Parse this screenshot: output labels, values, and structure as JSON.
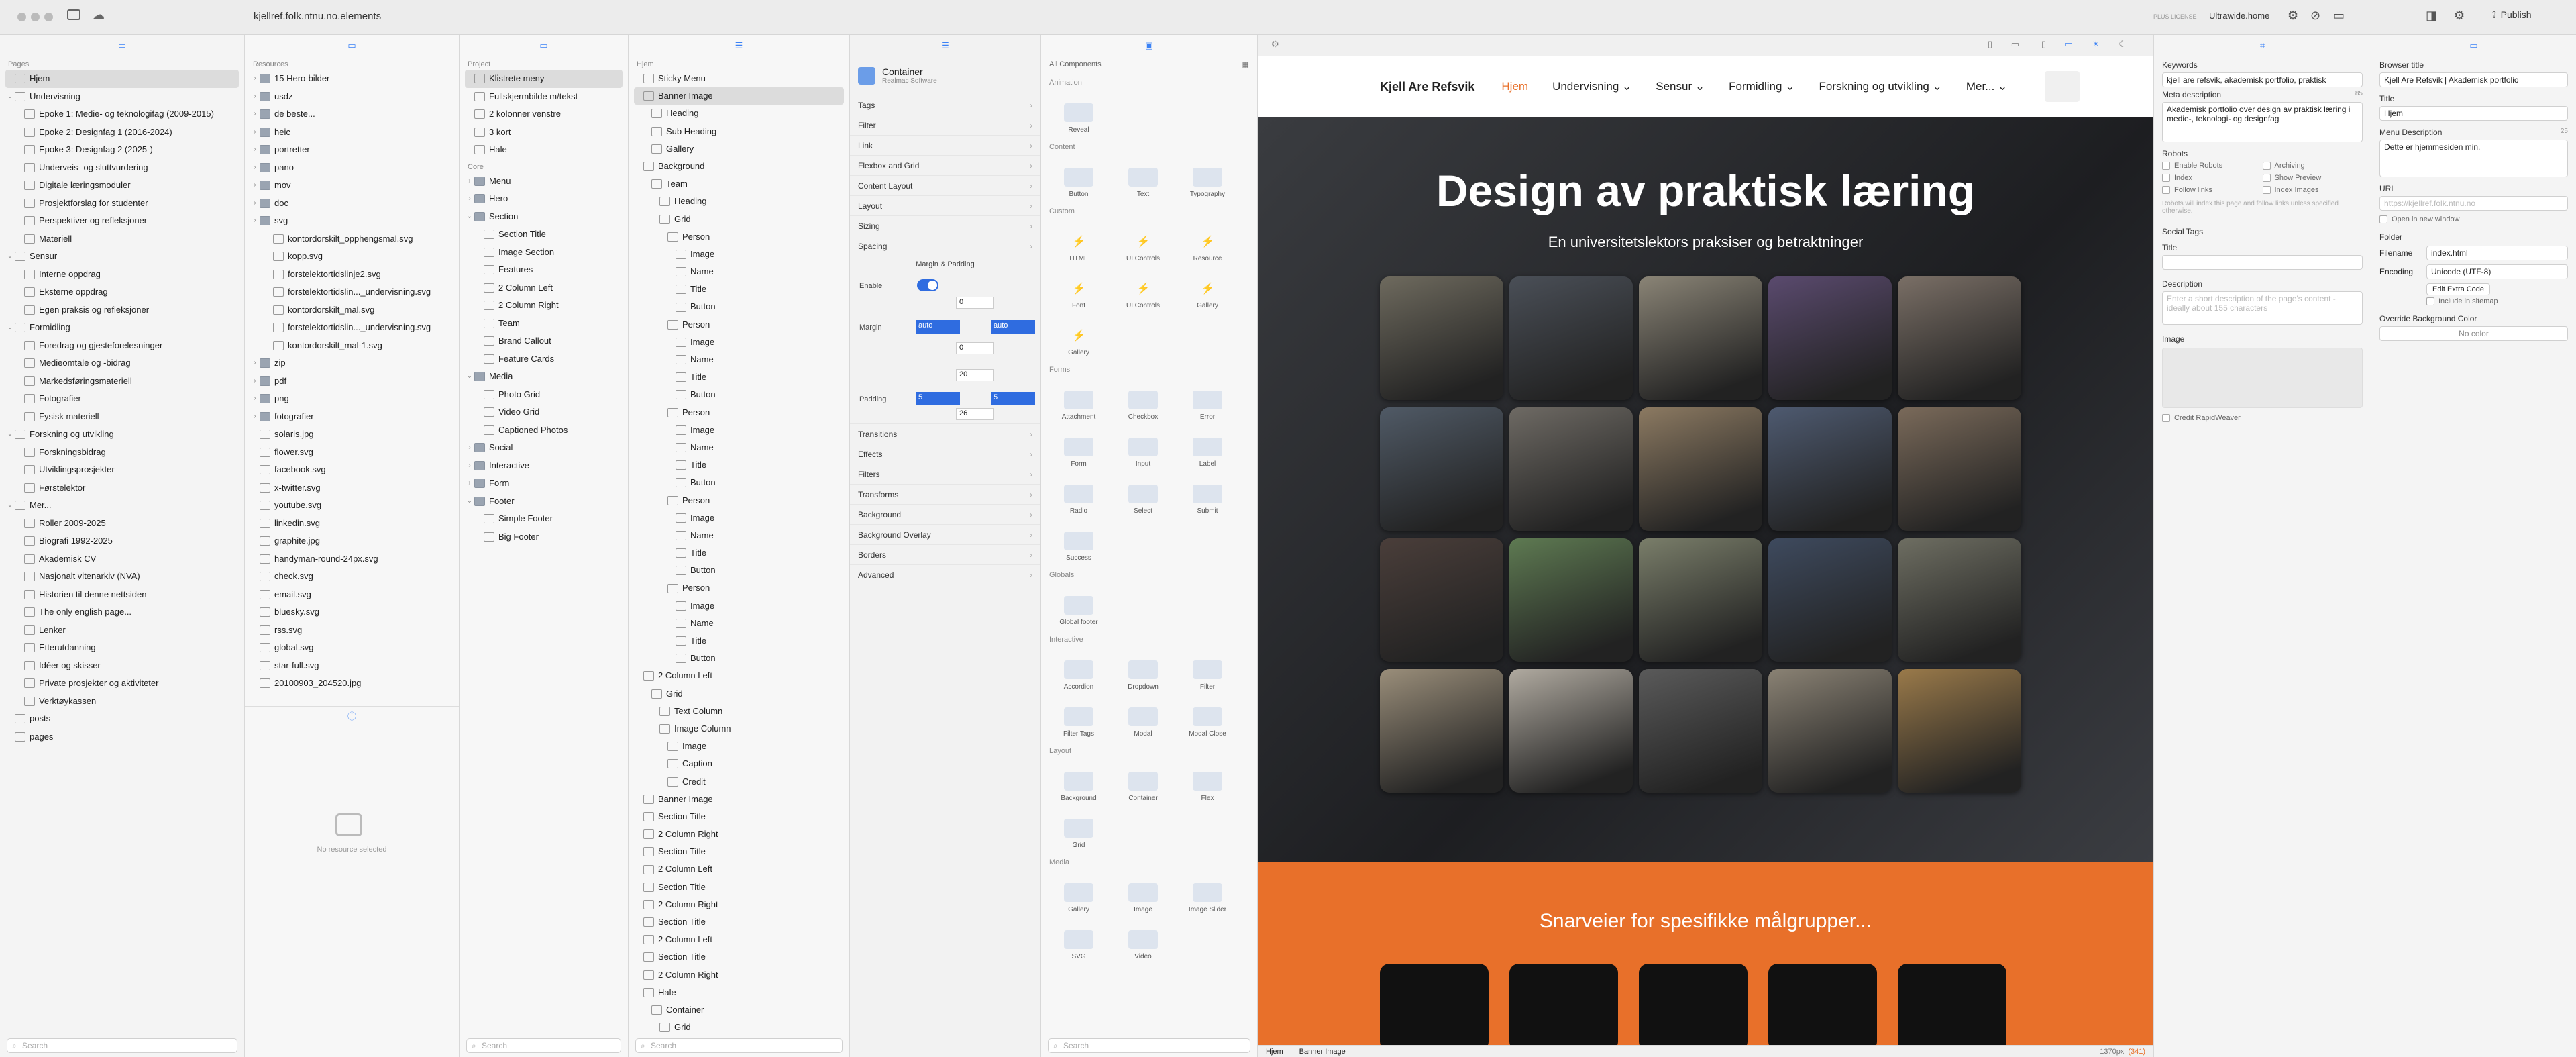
{
  "titlebar": {
    "site_url": "kjellref.folk.ntnu.no.elements",
    "license": "PLUS LICENSE",
    "account": "Ultrawide.home",
    "publish_label": "Publish"
  },
  "pages": {
    "header": "Pages",
    "items": [
      {
        "label": "Hjem",
        "level": 0,
        "selected": true
      },
      {
        "label": "Undervisning",
        "level": 0,
        "open": true
      },
      {
        "label": "Epoke 1: Medie- og teknologifag (2009-2015)",
        "level": 1
      },
      {
        "label": "Epoke 2: Designfag 1 (2016-2024)",
        "level": 1
      },
      {
        "label": "Epoke 3: Designfag 2 (2025-)",
        "level": 1
      },
      {
        "label": "Underveis- og sluttvurdering",
        "level": 1
      },
      {
        "label": "Digitale læringsmoduler",
        "level": 1
      },
      {
        "label": "Prosjektforslag for studenter",
        "level": 1
      },
      {
        "label": "Perspektiver og refleksjoner",
        "level": 1
      },
      {
        "label": "Materiell",
        "level": 1
      },
      {
        "label": "Sensur",
        "level": 0,
        "open": true
      },
      {
        "label": "Interne oppdrag",
        "level": 1
      },
      {
        "label": "Eksterne oppdrag",
        "level": 1
      },
      {
        "label": "Egen praksis og refleksjoner",
        "level": 1
      },
      {
        "label": "Formidling",
        "level": 0,
        "open": true
      },
      {
        "label": "Foredrag og gjesteforelesninger",
        "level": 1
      },
      {
        "label": "Medieomtale og -bidrag",
        "level": 1
      },
      {
        "label": "Markedsføringsmateriell",
        "level": 1
      },
      {
        "label": "Fotografier",
        "level": 1
      },
      {
        "label": "Fysisk materiell",
        "level": 1
      },
      {
        "label": "Forskning og utvikling",
        "level": 0,
        "open": true
      },
      {
        "label": "Forskningsbidrag",
        "level": 1
      },
      {
        "label": "Utviklingsprosjekter",
        "level": 1
      },
      {
        "label": "Førstelektor",
        "level": 1
      },
      {
        "label": "Mer...",
        "level": 0,
        "open": true
      },
      {
        "label": "Roller 2009-2025",
        "level": 1
      },
      {
        "label": "Biografi 1992-2025",
        "level": 1
      },
      {
        "label": "Akademisk CV",
        "level": 1
      },
      {
        "label": "Nasjonalt vitenarkiv (NVA)",
        "level": 1
      },
      {
        "label": "Historien til denne nettsiden",
        "level": 1
      },
      {
        "label": "The only english page...",
        "level": 1
      },
      {
        "label": "Lenker",
        "level": 1
      },
      {
        "label": "Etterutdanning",
        "level": 1
      },
      {
        "label": "Idéer og skisser",
        "level": 1
      },
      {
        "label": "Private prosjekter og aktiviteter",
        "level": 1
      },
      {
        "label": "Verktøykassen",
        "level": 1
      },
      {
        "label": "posts",
        "level": 0
      },
      {
        "label": "pages",
        "level": 0
      }
    ],
    "search_placeholder": "Search"
  },
  "resources": {
    "header": "Resources",
    "items": [
      {
        "label": "15 Hero-bilder",
        "kind": "folder",
        "level": 0
      },
      {
        "label": "usdz",
        "kind": "folder",
        "level": 0
      },
      {
        "label": "de beste...",
        "kind": "folder",
        "level": 0
      },
      {
        "label": "heic",
        "kind": "folder",
        "level": 0
      },
      {
        "label": "portretter",
        "kind": "folder",
        "level": 0
      },
      {
        "label": "pano",
        "kind": "folder",
        "level": 0
      },
      {
        "label": "mov",
        "kind": "folder",
        "level": 0
      },
      {
        "label": "doc",
        "kind": "folder",
        "level": 0
      },
      {
        "label": "svg",
        "kind": "folder",
        "level": 0
      },
      {
        "label": "kontordorskilt_opphengsmal.svg",
        "kind": "file",
        "level": 1
      },
      {
        "label": "kopp.svg",
        "kind": "file",
        "level": 1
      },
      {
        "label": "forstelektortidslinje2.svg",
        "kind": "file",
        "level": 1
      },
      {
        "label": "forstelektortidslin..._undervisning.svg",
        "kind": "file",
        "level": 1
      },
      {
        "label": "kontordorskilt_mal.svg",
        "kind": "file",
        "level": 1
      },
      {
        "label": "forstelektortidslin..._undervisning.svg",
        "kind": "file",
        "level": 1
      },
      {
        "label": "kontordorskilt_mal-1.svg",
        "kind": "file",
        "level": 1
      },
      {
        "label": "zip",
        "kind": "folder",
        "level": 0
      },
      {
        "label": "pdf",
        "kind": "folder",
        "level": 0
      },
      {
        "label": "png",
        "kind": "folder",
        "level": 0
      },
      {
        "label": "fotografier",
        "kind": "folder",
        "level": 0
      },
      {
        "label": "solaris.jpg",
        "kind": "file",
        "level": 0
      },
      {
        "label": "flower.svg",
        "kind": "file",
        "level": 0
      },
      {
        "label": "facebook.svg",
        "kind": "file",
        "level": 0
      },
      {
        "label": "x-twitter.svg",
        "kind": "file",
        "level": 0
      },
      {
        "label": "youtube.svg",
        "kind": "file",
        "level": 0
      },
      {
        "label": "linkedin.svg",
        "kind": "file",
        "level": 0
      },
      {
        "label": "graphite.jpg",
        "kind": "file",
        "level": 0
      },
      {
        "label": "handyman-round-24px.svg",
        "kind": "file",
        "level": 0
      },
      {
        "label": "check.svg",
        "kind": "file",
        "level": 0
      },
      {
        "label": "email.svg",
        "kind": "file",
        "level": 0
      },
      {
        "label": "bluesky.svg",
        "kind": "file",
        "level": 0
      },
      {
        "label": "rss.svg",
        "kind": "file",
        "level": 0
      },
      {
        "label": "global.svg",
        "kind": "file",
        "level": 0
      },
      {
        "label": "star-full.svg",
        "kind": "file",
        "level": 0
      },
      {
        "label": "20100903_204520.jpg",
        "kind": "file",
        "level": 0
      }
    ],
    "search_placeholder": "Search",
    "empty_label": "No resource selected"
  },
  "project": {
    "header": "Project",
    "items": [
      {
        "label": "Klistrete meny",
        "level": 0,
        "selected": true
      },
      {
        "label": "Fullskjermbilde m/tekst",
        "level": 0
      },
      {
        "label": "2 kolonner venstre",
        "level": 0
      },
      {
        "label": "3 kort",
        "level": 0
      },
      {
        "label": "Hale",
        "level": 0
      }
    ],
    "core_header": "Core",
    "core_items": [
      {
        "label": "Menu",
        "level": 0,
        "kind": "folder"
      },
      {
        "label": "Hero",
        "level": 0,
        "kind": "folder"
      },
      {
        "label": "Section",
        "level": 0,
        "kind": "folder",
        "open": true
      },
      {
        "label": "Section Title",
        "level": 1
      },
      {
        "label": "Image Section",
        "level": 1
      },
      {
        "label": "Features",
        "level": 1
      },
      {
        "label": "2 Column Left",
        "level": 1
      },
      {
        "label": "2 Column Right",
        "level": 1
      },
      {
        "label": "Team",
        "level": 1
      },
      {
        "label": "Brand Callout",
        "level": 1
      },
      {
        "label": "Feature Cards",
        "level": 1
      },
      {
        "label": "Media",
        "level": 0,
        "kind": "folder",
        "open": true
      },
      {
        "label": "Photo Grid",
        "level": 1
      },
      {
        "label": "Video Grid",
        "level": 1
      },
      {
        "label": "Captioned Photos",
        "level": 1
      },
      {
        "label": "Social",
        "level": 0,
        "kind": "folder"
      },
      {
        "label": "Interactive",
        "level": 0,
        "kind": "folder"
      },
      {
        "label": "Form",
        "level": 0,
        "kind": "folder"
      },
      {
        "label": "Footer",
        "level": 0,
        "kind": "folder",
        "open": true
      },
      {
        "label": "Simple Footer",
        "level": 1
      },
      {
        "label": "Big Footer",
        "level": 1
      }
    ],
    "search_placeholder": "Search"
  },
  "outline": {
    "header": "Hjem",
    "items": [
      {
        "label": "Sticky Menu",
        "level": 0
      },
      {
        "label": "Banner Image",
        "level": 0,
        "selected": true
      },
      {
        "label": "Heading",
        "level": 1
      },
      {
        "label": "Sub Heading",
        "level": 1
      },
      {
        "label": "Gallery",
        "level": 1
      },
      {
        "label": "Background",
        "level": 0
      },
      {
        "label": "Team",
        "level": 1
      },
      {
        "label": "Heading",
        "level": 2
      },
      {
        "label": "Grid",
        "level": 2
      },
      {
        "label": "Person",
        "level": 3
      },
      {
        "label": "Image",
        "level": 4
      },
      {
        "label": "Name",
        "level": 4
      },
      {
        "label": "Title",
        "level": 4
      },
      {
        "label": "Button",
        "level": 4
      },
      {
        "label": "Person",
        "level": 3
      },
      {
        "label": "Image",
        "level": 4
      },
      {
        "label": "Name",
        "level": 4
      },
      {
        "label": "Title",
        "level": 4
      },
      {
        "label": "Button",
        "level": 4
      },
      {
        "label": "Person",
        "level": 3
      },
      {
        "label": "Image",
        "level": 4
      },
      {
        "label": "Name",
        "level": 4
      },
      {
        "label": "Title",
        "level": 4
      },
      {
        "label": "Button",
        "level": 4
      },
      {
        "label": "Person",
        "level": 3
      },
      {
        "label": "Image",
        "level": 4
      },
      {
        "label": "Name",
        "level": 4
      },
      {
        "label": "Title",
        "level": 4
      },
      {
        "label": "Button",
        "level": 4
      },
      {
        "label": "Person",
        "level": 3
      },
      {
        "label": "Image",
        "level": 4
      },
      {
        "label": "Name",
        "level": 4
      },
      {
        "label": "Title",
        "level": 4
      },
      {
        "label": "Button",
        "level": 4
      },
      {
        "label": "2 Column Left",
        "level": 0
      },
      {
        "label": "Grid",
        "level": 1
      },
      {
        "label": "Text Column",
        "level": 2
      },
      {
        "label": "Image Column",
        "level": 2
      },
      {
        "label": "Image",
        "level": 3
      },
      {
        "label": "Caption",
        "level": 3
      },
      {
        "label": "Credit",
        "level": 3
      },
      {
        "label": "Banner Image",
        "level": 0
      },
      {
        "label": "Section Title",
        "level": 0
      },
      {
        "label": "2 Column Right",
        "level": 0
      },
      {
        "label": "Section Title",
        "level": 0
      },
      {
        "label": "2 Column Left",
        "level": 0
      },
      {
        "label": "Section Title",
        "level": 0
      },
      {
        "label": "2 Column Right",
        "level": 0
      },
      {
        "label": "Section Title",
        "level": 0
      },
      {
        "label": "2 Column Left",
        "level": 0
      },
      {
        "label": "Section Title",
        "level": 0
      },
      {
        "label": "2 Column Right",
        "level": 0
      },
      {
        "label": "Hale",
        "level": 0
      },
      {
        "label": "Container",
        "level": 1
      },
      {
        "label": "Grid",
        "level": 2
      }
    ],
    "search_placeholder": "Search"
  },
  "inspector": {
    "component_name": "Container",
    "component_vendor": "Realmac Software",
    "rows": [
      "Tags",
      "Filter",
      "Link",
      "Flexbox and Grid",
      "Content Layout",
      "Layout",
      "Sizing",
      "Spacing"
    ],
    "spacing": {
      "title": "Margin & Padding",
      "enable_label": "Enable",
      "margin_label": "Margin",
      "padding_label": "Padding",
      "margin_top": "0",
      "margin_left": "auto",
      "margin_right": "auto",
      "margin_bottom": "0",
      "padding_top": "20",
      "padding_left": "5",
      "padding_right": "5",
      "padding_bottom": "26"
    },
    "rows2": [
      "Transitions",
      "Effects",
      "Filters",
      "Transforms",
      "Background",
      "Background Overlay",
      "Borders",
      "Advanced"
    ]
  },
  "components": {
    "header": "All Components",
    "groups": [
      {
        "name": "Animation",
        "items": [
          "Reveal"
        ]
      },
      {
        "name": "Content",
        "items": [
          "Button",
          "Text",
          "Typography"
        ]
      },
      {
        "name": "Custom",
        "items": [
          "HTML",
          "UI Controls",
          "Resource",
          "Font",
          "UI Controls",
          "Gallery",
          "Gallery"
        ]
      },
      {
        "name": "Forms",
        "items": [
          "Attachment",
          "Checkbox",
          "Error",
          "Form",
          "Input",
          "Label",
          "Radio",
          "Select",
          "Submit",
          "Success"
        ]
      },
      {
        "name": "Globals",
        "items": [
          "Global footer"
        ]
      },
      {
        "name": "Interactive",
        "items": [
          "Accordion",
          "Dropdown",
          "Filter",
          "Filter Tags",
          "Modal",
          "Modal Close"
        ]
      },
      {
        "name": "Layout",
        "items": [
          "Background",
          "Container",
          "Flex",
          "Grid"
        ]
      },
      {
        "name": "Media",
        "items": [
          "Gallery",
          "Image",
          "Image Slider",
          "SVG",
          "Video"
        ]
      }
    ],
    "search_placeholder": "Search"
  },
  "preview": {
    "site_name": "Kjell Are Refsvik",
    "nav": [
      "Hjem",
      "Undervisning",
      "Sensur",
      "Formidling",
      "Forskning og utvikling",
      "Mer..."
    ],
    "hero_title": "Design av praktisk læring",
    "hero_subtitle": "En universitetslektors praksiser og betraktninger",
    "section_title": "Snarveier for spesifikke målgrupper...",
    "accent_color": "#e8702a",
    "footer_breadcrumb": [
      "Hjem",
      "Banner Image"
    ],
    "footer_size": "1370px",
    "footer_size_extra": "(341)"
  },
  "seo": {
    "keywords_label": "Keywords",
    "keywords_value": "kjell are refsvik, akademisk portfolio, praktisk",
    "meta_label": "Meta description",
    "meta_count": "85",
    "meta_value": "Akademisk portfolio over design av praktisk læring i medie-, teknologi- og designfag",
    "robots_label": "Robots",
    "robots_options": [
      "Enable Robots",
      "Archiving",
      "Index",
      "Show Preview",
      "Follow links",
      "Index Images"
    ],
    "robots_note": "Robots will index this page and follow links unless specified otherwise.",
    "social_label": "Social Tags",
    "title_label": "Title",
    "description_label": "Description",
    "description_placeholder": "Enter a short description of the page's content - ideally about 155 characters",
    "image_label": "Image",
    "credit_label": "Credit RapidWeaver"
  },
  "page_settings": {
    "browser_title_label": "Browser title",
    "browser_title": "Kjell Are Refsvik | Akademisk portfolio",
    "title_label": "Title",
    "title_value": "Hjem",
    "menu_desc_label": "Menu Description",
    "menu_desc_count": "25",
    "menu_desc_value": "Dette er hjemmesiden min.",
    "url_label": "URL",
    "url_placeholder": "https://kjellref.folk.ntnu.no",
    "open_new_window": "Open in new window",
    "folder_label": "Folder",
    "filename_label": "Filename",
    "filename_value": "index.html",
    "encoding_label": "Encoding",
    "encoding_value": "Unicode (UTF-8)",
    "extra_code_label": "Edit Extra Code",
    "sitemap_label": "Include in sitemap",
    "override_bg_label": "Override Background Color",
    "no_color": "No color"
  }
}
